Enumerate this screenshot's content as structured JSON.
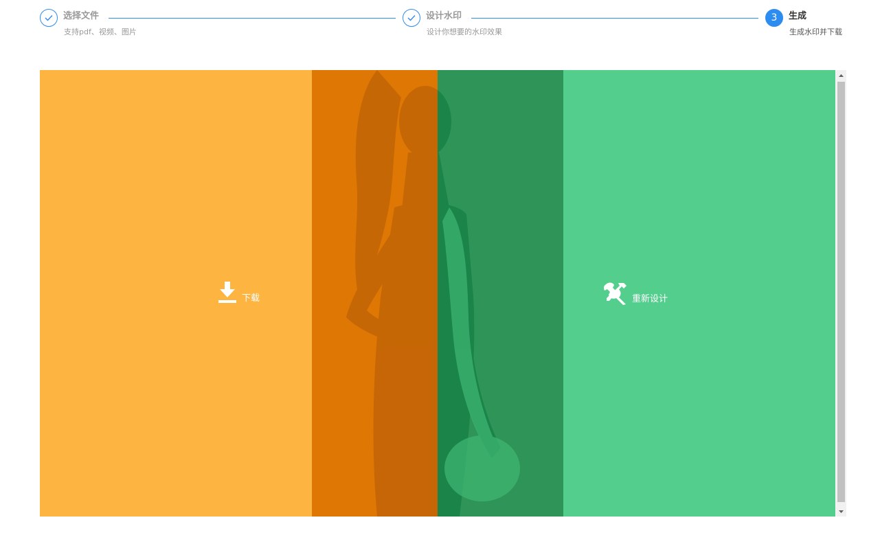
{
  "steps": [
    {
      "title": "选择文件",
      "desc": "支持pdf、视频、图片",
      "status": "done"
    },
    {
      "title": "设计水印",
      "desc": "设计你想要的水印效果",
      "status": "done"
    },
    {
      "number": "3",
      "title": "生成",
      "desc": "生成水印并下载",
      "status": "active"
    }
  ],
  "actions": {
    "download_label": "下载",
    "redesign_label": "重新设计"
  },
  "icons": {
    "step_done": "check-icon",
    "download": "download-icon",
    "redesign": "tools-icon"
  },
  "colors": {
    "accent": "#2d8cf0",
    "download_panel": "#fdb441",
    "download_overlay": "#de7703",
    "redesign_panel": "#53ce8d",
    "redesign_overlay": "#2f9457"
  }
}
